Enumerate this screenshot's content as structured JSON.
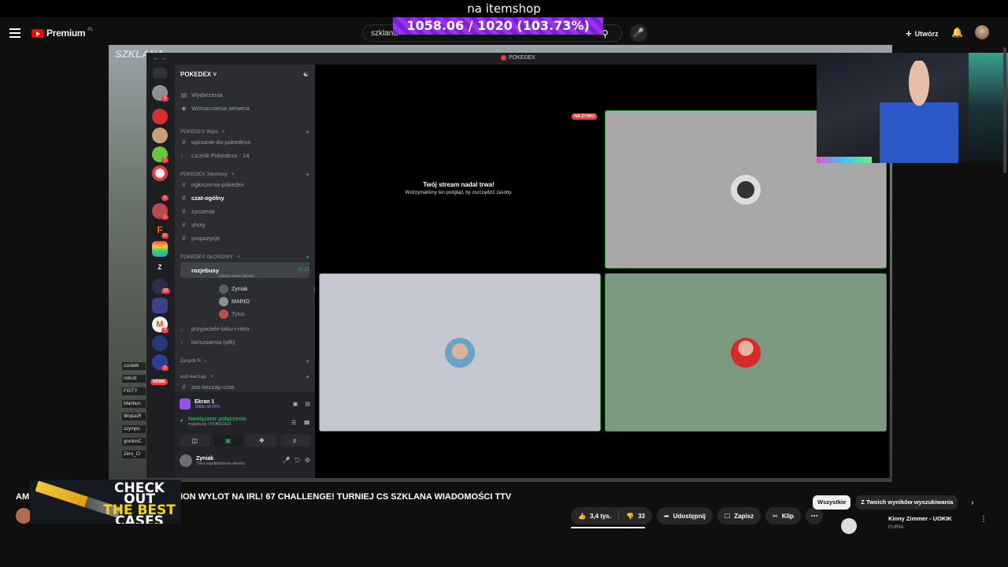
{
  "overlay": {
    "title": "na itemshop",
    "progress": "1058.06 / 1020 (103.73%)",
    "progress_fraction": 1.0373
  },
  "youtube": {
    "brand": "Premium",
    "brand_region": "PL",
    "search_value": "szklana",
    "create_label": "Utwórz",
    "video_title_start": "AM",
    "video_title": "ION WYLOT NA IRL! 67 CHALLENGE! TURNIEJ CS SZKLANA WIADOMOŚCI TTV",
    "likes": "3,4 tys.",
    "dislikes": "33",
    "share": "Udostępnij",
    "save": "Zapisz",
    "clip": "Klip",
    "chips": [
      "Wszystkie",
      "Z Twoich wyników wyszukiwania"
    ],
    "recommendation": {
      "title": "Kinny Zimmer - UOKIK",
      "channel": "FURIA"
    }
  },
  "ad": {
    "line1": "CHECK OUT",
    "line2": "THE BEST",
    "line3": "CASES"
  },
  "stream": {
    "brand_tag": "SZKLANA",
    "chat_users": [
      "cordeik",
      "rotkstt",
      "FIGTY",
      "Manhun",
      "WojtasR",
      "szympu",
      "gordonC",
      "Zero_Cl"
    ]
  },
  "discord": {
    "window_title": "POKEDEX",
    "server_name": "POKEDEX",
    "top_items": [
      "Wydarzenia",
      "Wzmocnienia serwera"
    ],
    "categories": {
      "wpis": "POKEDEX Wpis",
      "tekstowy": "POKEDEX Tekstowy",
      "glosowy": "POKEDEX GŁOSOWY",
      "zespol": "Zespół R",
      "asz": "asz-keczap"
    },
    "channels_wpis": [
      "wpisanie-do-pokedexa",
      "Licznik Pokedexa - 14"
    ],
    "channels_text": [
      "ogłoszenia-pokedex",
      "czat-ogólny",
      "życzenia",
      "shoty",
      "propozycje"
    ],
    "voice_channel": "rozjebusy",
    "voice_status": "Ustaw status kanału",
    "voice_timer": "41:21",
    "voice_users": [
      "Zyniak",
      "MARIO",
      "Tytus"
    ],
    "live_label": "NA ŻYWO",
    "channels_after": [
      "przyjaciele-taku-i-nitro",
      "lamusiarnia (afk)"
    ],
    "channel_asz": "asz-keczap-czat",
    "rail_badges": [
      "4",
      "1",
      "5",
      "1",
      "4",
      "17",
      "63",
      "3"
    ],
    "new_label": "NOWE",
    "stream_panel": {
      "title": "Ekran 1",
      "sub": "1080p 60 FPS"
    },
    "connection": {
      "title": "Nawiązano połączenie",
      "sub": "rozjebusy / POKEDEX"
    },
    "user": {
      "name": "Zyniak",
      "status": "Trwa współdzielenie ekranu"
    },
    "stream_msg": {
      "title": "Twój stream nadal trwa!",
      "sub": "Wstrzymaliśmy ten podgląd, by oszczędzić zasoby."
    }
  }
}
